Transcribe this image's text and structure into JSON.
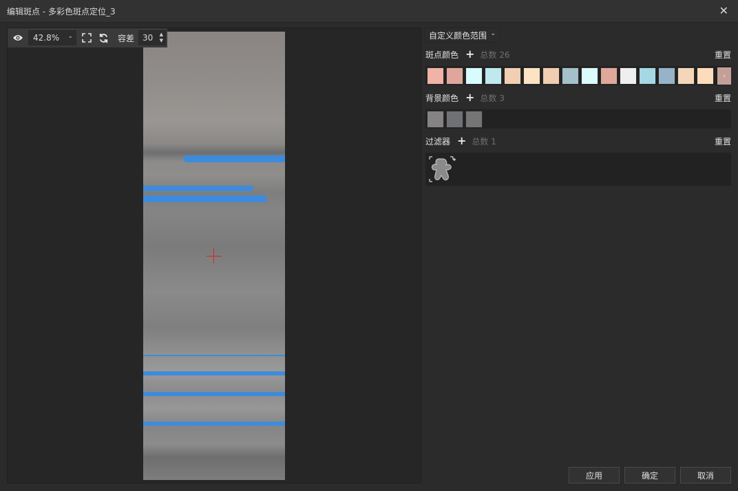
{
  "window": {
    "title": "编辑斑点 - 多彩色斑点定位_3",
    "close_icon": "close-icon"
  },
  "toolbar": {
    "zoom_value": "42.8%",
    "tolerance_label": "容差",
    "tolerance_value": "30"
  },
  "color_range": {
    "selected": "自定义颜色范围"
  },
  "spot_colors": {
    "label": "斑点颜色",
    "count_text": "总数 26",
    "reset_label": "重置",
    "swatches": [
      "#f0b3a5",
      "#dfa79c",
      "#d8fbfc",
      "#bfe8ef",
      "#f1cfb3",
      "#fde3c4",
      "#f0ccb0",
      "#a3c0cb",
      "#dcfbfd",
      "#dfa89b",
      "#efefef",
      "#a3d8e4",
      "#96b3c8",
      "#f4d6bb",
      "#fcdcba"
    ],
    "more_label": "›"
  },
  "bg_colors": {
    "label": "背景颜色",
    "count_text": "总数 3",
    "reset_label": "重置",
    "swatches": [
      "#868384",
      "#6f7174",
      "#757575"
    ]
  },
  "filters": {
    "label": "过滤器",
    "count_text": "总数 1",
    "reset_label": "重置"
  },
  "buttons": {
    "apply": "应用",
    "confirm": "确定",
    "cancel": "取消"
  }
}
